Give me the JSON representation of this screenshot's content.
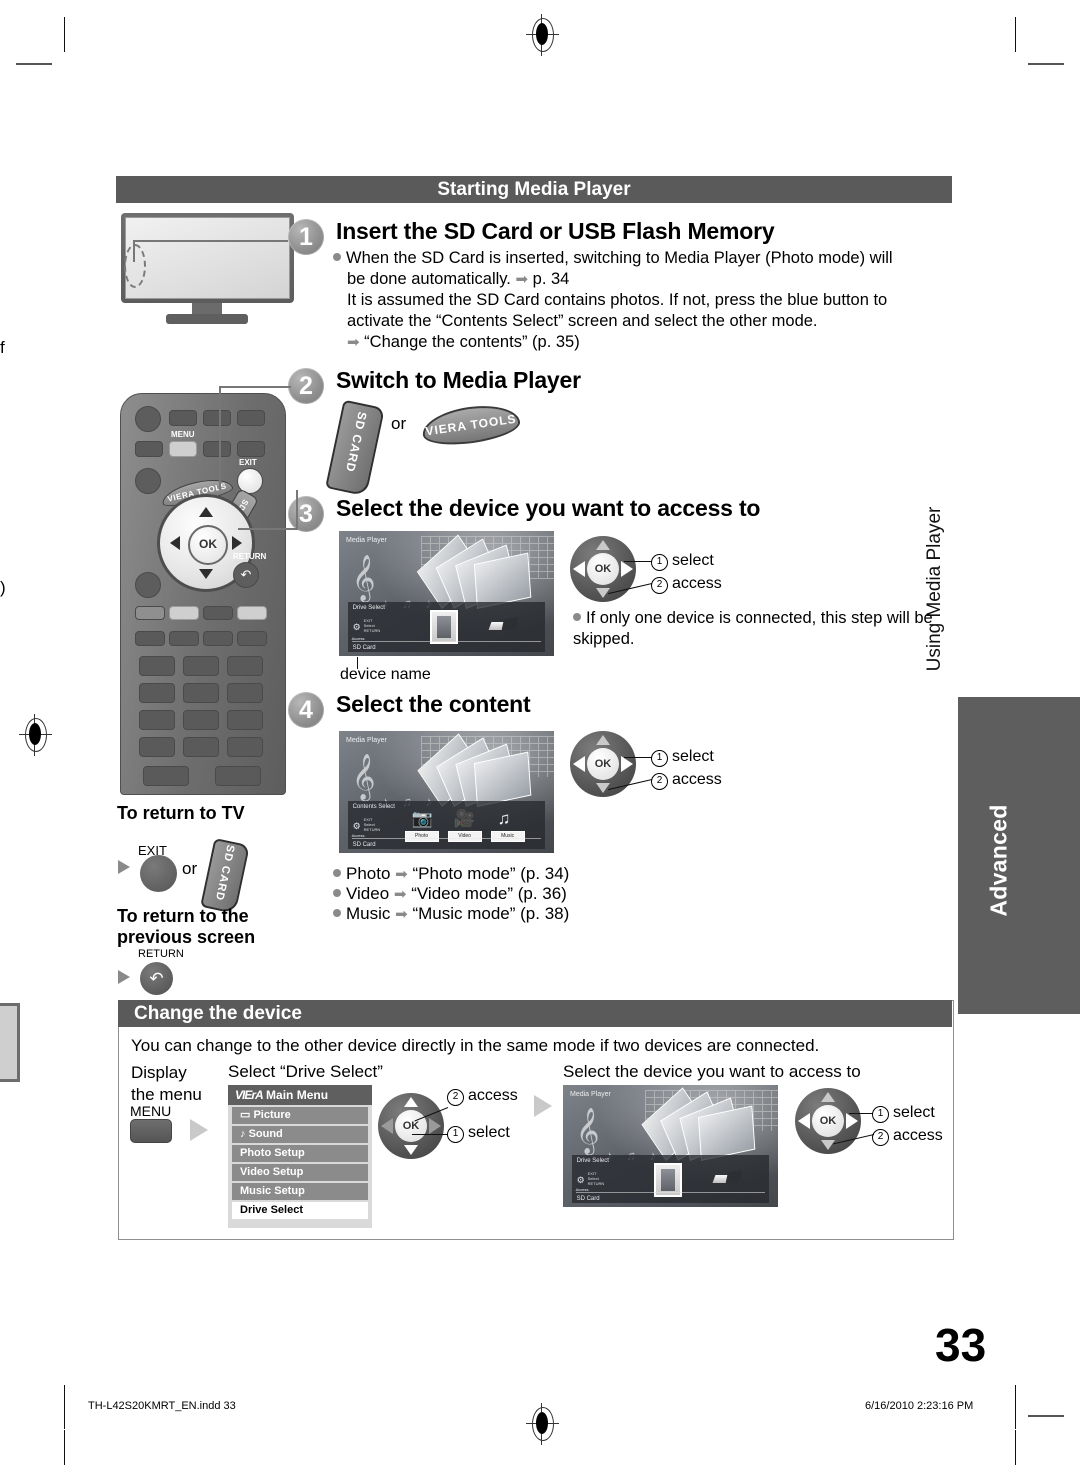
{
  "page": {
    "number": "33",
    "footer_file": "TH-L42S20KMRT_EN.indd   33",
    "footer_timestamp": "6/16/2010   2:23:16 PM",
    "running_head": "Using Media Player",
    "side_tab": "Advanced",
    "edge_fragment_top": "f",
    "edge_fragment_mid": ")"
  },
  "starting_section": {
    "header": "Starting Media Player",
    "steps": [
      {
        "num": "1",
        "title": "Insert the SD Card or USB Flash Memory",
        "lines": [
          "When the SD Card is inserted, switching to Media Player (Photo mode) will",
          "be done automatically.",
          "p. 34",
          "It is assumed the SD Card contains photos. If not, press the blue button to",
          "activate the “Contents Select” screen and select the other mode.",
          "“Change the contents” (p. 35)"
        ]
      },
      {
        "num": "2",
        "title": "Switch to Media Player",
        "key_sd": "SD CARD",
        "or_label": "or",
        "key_viera": "VIERA TOOLS"
      },
      {
        "num": "3",
        "title": "Select the device you want to access to",
        "callout1": "select",
        "callout2": "access",
        "callout_num1": "1",
        "callout_num2": "2",
        "note": "If only one device is connected, this step will be skipped.",
        "caption": "device name"
      },
      {
        "num": "4",
        "title": "Select the content",
        "callout1": "select",
        "callout2": "access",
        "callout_num1": "1",
        "callout_num2": "2",
        "modes": [
          {
            "name": "Photo",
            "target": "“Photo mode” (p. 34)"
          },
          {
            "name": "Video",
            "target": "“Video mode” (p. 36)"
          },
          {
            "name": "Music",
            "target": "“Music mode” (p. 38)"
          }
        ]
      }
    ]
  },
  "return_block": {
    "title_tv": "To return to TV",
    "exit_label": "EXIT",
    "or_label": "or",
    "sd_label": "SD CARD",
    "title_prev_line1": "To return to the",
    "title_prev_line2": "previous screen",
    "return_label": "RETURN",
    "return_glyph": "↰"
  },
  "change_section": {
    "header": "Change the device",
    "intro": "You can change to the other device directly in the same mode if two devices are connected.",
    "col1_line1": "Display",
    "col1_line2": "the menu",
    "menu_button_label": "MENU",
    "col2_heading": "Select “Drive Select”",
    "col3_heading": "Select the device you want to access to",
    "pad_left": {
      "num1": "1",
      "label1": "select",
      "num2": "2",
      "label2": "access"
    },
    "pad_right": {
      "num1": "1",
      "label1": "select",
      "num2": "2",
      "label2": "access"
    }
  },
  "viera_menu": {
    "logo": "VIErA",
    "title": "Main Menu",
    "items": [
      {
        "label": "Picture",
        "icon": "picture-icon",
        "selected": false
      },
      {
        "label": "Sound",
        "icon": "sound-icon",
        "selected": false
      },
      {
        "label": "Photo Setup",
        "icon": "",
        "selected": false
      },
      {
        "label": "Video Setup",
        "icon": "",
        "selected": false
      },
      {
        "label": "Music Setup",
        "icon": "",
        "selected": false
      },
      {
        "label": "Drive Select",
        "icon": "",
        "selected": true
      }
    ]
  },
  "drive_select_screen": {
    "app_title": "Media Player",
    "osd_title": "Drive Select",
    "hints": [
      "EXIT",
      "Select",
      "RETURN"
    ],
    "access_label": "Access",
    "device_name": "SD Card",
    "items": [
      "sd-card-icon",
      "usb-drive-icon"
    ]
  },
  "contents_select_screen": {
    "app_title": "Media Player",
    "osd_title": "Contents Select",
    "hints": [
      "EXIT",
      "Select",
      "RETURN"
    ],
    "access_label": "Access",
    "device_name": "SD Card",
    "tiles": [
      "Photo",
      "Video",
      "Music"
    ]
  },
  "remote": {
    "menu_label": "MENU",
    "exit_label": "EXIT",
    "viera_tools_label": "VIERA TOOLS",
    "sd_card_label": "SD CARD",
    "return_label": "RETURN",
    "ok_label": "OK"
  },
  "colors": {
    "header_bar": "#5a5a5a",
    "side_tab": "#5e5e5e",
    "step_circle": "#8d8d8d",
    "bullet": "#8a8a8a",
    "menu_row": "#8b8b8b",
    "menu_selected": "#ffffff"
  }
}
